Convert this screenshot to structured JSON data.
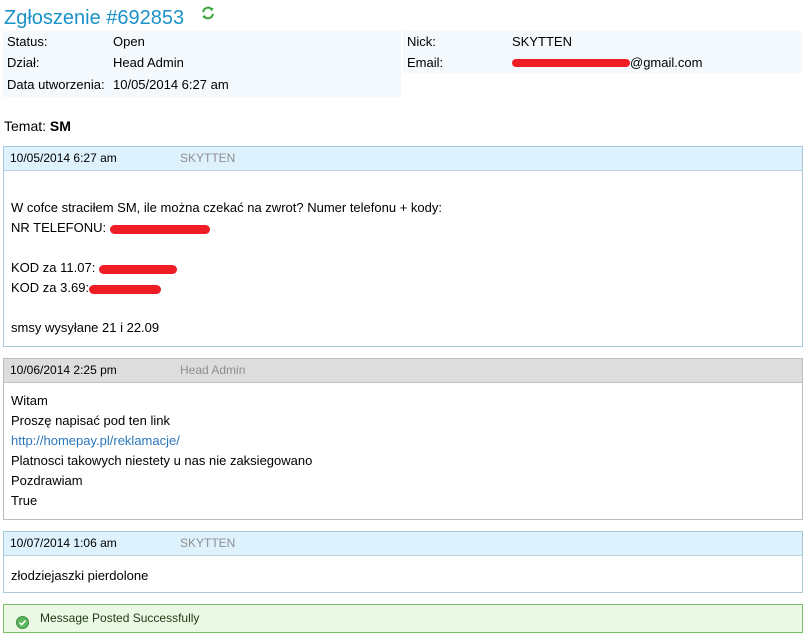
{
  "ticket": {
    "title": "Zgłoszenie #692853",
    "status_label": "Status:",
    "status_value": "Open",
    "department_label": "Dział:",
    "department_value": "Head Admin",
    "created_label": "Data utworzenia:",
    "created_value": "10/05/2014 6:27 am",
    "nick_label": "Nick:",
    "nick_value": "SKYTTEN",
    "email_label": "Email:",
    "email_value_suffix": "@gmail.com"
  },
  "subject": {
    "label": "Temat:",
    "value": "SM"
  },
  "messages": [
    {
      "date": "10/05/2014 6:27 am",
      "author": "SKYTTEN",
      "lines": [
        "W cofce straciłem SM, ile można czekać na zwrot? Numer telefonu + kody:",
        "NR TELEFONU:",
        "KOD za 11.07:",
        "KOD za 3.69:",
        "smsy wysyłane 21 i 22.09"
      ]
    },
    {
      "date": "10/06/2014 2:25 pm",
      "author": "Head Admin",
      "lines": [
        "Witam",
        "Proszę napisać pod ten link",
        "http://homepay.pl/reklamacje/",
        "Platnosci takowych niestety u nas nie zaksiegowano",
        "Pozdrawiam",
        "True"
      ]
    },
    {
      "date": "10/07/2014 1:06 am",
      "author": "SKYTTEN",
      "lines": [
        "złodziejaszki pierdolone"
      ]
    }
  ],
  "notice": {
    "text": "Message Posted Successfully"
  },
  "colors": {
    "title": "#1a92c8",
    "user_header": "#def2fe",
    "admin_header": "#dddddd",
    "success_bg": "#ebf8e6",
    "success_border": "#7cbf6b",
    "redaction": "#ee1c25",
    "link": "#2a78bd"
  },
  "icons": {
    "refresh": "refresh-icon",
    "success": "check-circle-icon"
  }
}
